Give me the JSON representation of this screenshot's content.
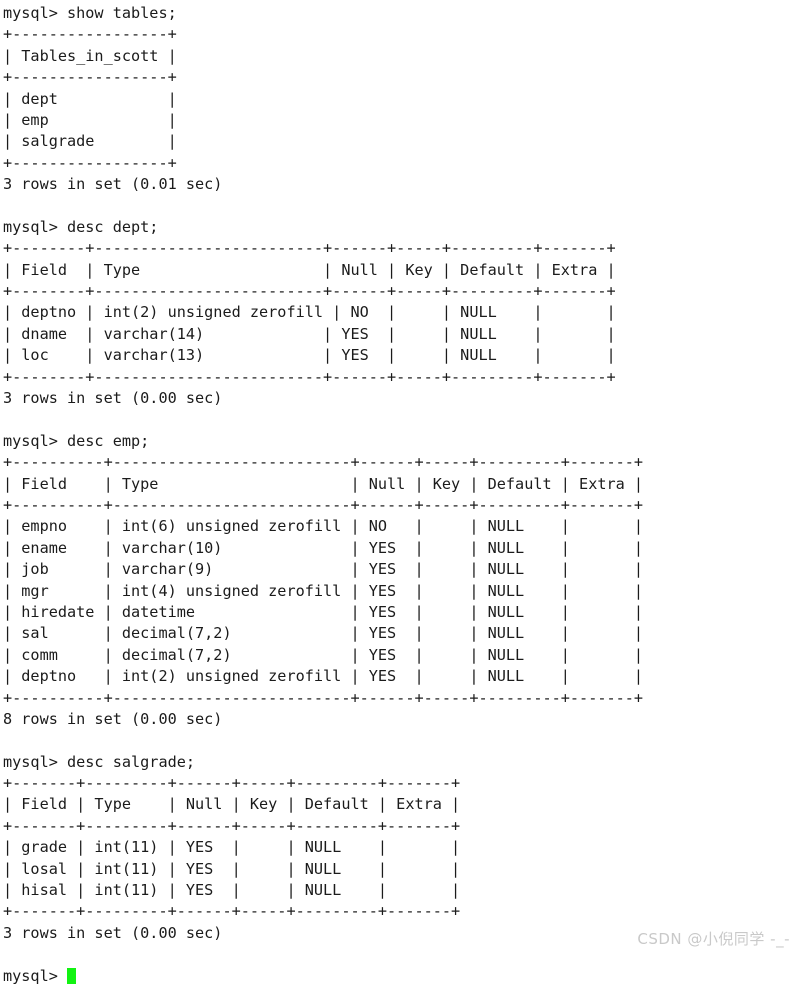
{
  "terminal": {
    "prompt": "mysql>",
    "cursor_color": "#12f312",
    "text_color": "#1b1b1b",
    "background_color": "#ffffff",
    "blocks": [
      {
        "command": "mysql> show tables;",
        "lines": [
          "+-----------------+",
          "| Tables_in_scott |",
          "+-----------------+",
          "| dept            |",
          "| emp             |",
          "| salgrade        |",
          "+-----------------+",
          "3 rows in set (0.01 sec)"
        ]
      },
      {
        "command": "mysql> desc dept;",
        "lines": [
          "+--------+-------------------------+------+-----+---------+-------+",
          "| Field  | Type                    | Null | Key | Default | Extra |",
          "+--------+-------------------------+------+-----+---------+-------+",
          "| deptno | int(2) unsigned zerofill | NO  |     | NULL    |       |",
          "| dname  | varchar(14)             | YES  |     | NULL    |       |",
          "| loc    | varchar(13)             | YES  |     | NULL    |       |",
          "+--------+-------------------------+------+-----+---------+-------+",
          "3 rows in set (0.00 sec)"
        ]
      },
      {
        "command": "mysql> desc emp;",
        "lines": [
          "+----------+--------------------------+------+-----+---------+-------+",
          "| Field    | Type                     | Null | Key | Default | Extra |",
          "+----------+--------------------------+------+-----+---------+-------+",
          "| empno    | int(6) unsigned zerofill | NO   |     | NULL    |       |",
          "| ename    | varchar(10)              | YES  |     | NULL    |       |",
          "| job      | varchar(9)               | YES  |     | NULL    |       |",
          "| mgr      | int(4) unsigned zerofill | YES  |     | NULL    |       |",
          "| hiredate | datetime                 | YES  |     | NULL    |       |",
          "| sal      | decimal(7,2)             | YES  |     | NULL    |       |",
          "| comm     | decimal(7,2)             | YES  |     | NULL    |       |",
          "| deptno   | int(2) unsigned zerofill | YES  |     | NULL    |       |",
          "+----------+--------------------------+------+-----+---------+-------+",
          "8 rows in set (0.00 sec)"
        ]
      },
      {
        "command": "mysql> desc salgrade;",
        "lines": [
          "+-------+---------+------+-----+---------+-------+",
          "| Field | Type    | Null | Key | Default | Extra |",
          "+-------+---------+------+-----+---------+-------+",
          "| grade | int(11) | YES  |     | NULL    |       |",
          "| losal | int(11) | YES  |     | NULL    |       |",
          "| hisal | int(11) | YES  |     | NULL    |       |",
          "+-------+---------+------+-----+---------+-------+",
          "3 rows in set (0.00 sec)"
        ]
      }
    ],
    "tables": {
      "show_tables": {
        "header": "Tables_in_scott",
        "rows": [
          "dept",
          "emp",
          "salgrade"
        ],
        "row_count": 3,
        "duration": "0.01 sec"
      },
      "dept": {
        "columns": [
          "Field",
          "Type",
          "Null",
          "Key",
          "Default",
          "Extra"
        ],
        "rows": [
          [
            "deptno",
            "int(2) unsigned zerofill",
            "NO",
            "",
            "NULL",
            ""
          ],
          [
            "dname",
            "varchar(14)",
            "YES",
            "",
            "NULL",
            ""
          ],
          [
            "loc",
            "varchar(13)",
            "YES",
            "",
            "NULL",
            ""
          ]
        ],
        "row_count": 3,
        "duration": "0.00 sec"
      },
      "emp": {
        "columns": [
          "Field",
          "Type",
          "Null",
          "Key",
          "Default",
          "Extra"
        ],
        "rows": [
          [
            "empno",
            "int(6) unsigned zerofill",
            "NO",
            "",
            "NULL",
            ""
          ],
          [
            "ename",
            "varchar(10)",
            "YES",
            "",
            "NULL",
            ""
          ],
          [
            "job",
            "varchar(9)",
            "YES",
            "",
            "NULL",
            ""
          ],
          [
            "mgr",
            "int(4) unsigned zerofill",
            "YES",
            "",
            "NULL",
            ""
          ],
          [
            "hiredate",
            "datetime",
            "YES",
            "",
            "NULL",
            ""
          ],
          [
            "sal",
            "decimal(7,2)",
            "YES",
            "",
            "NULL",
            ""
          ],
          [
            "comm",
            "decimal(7,2)",
            "YES",
            "",
            "NULL",
            ""
          ],
          [
            "deptno",
            "int(2) unsigned zerofill",
            "YES",
            "",
            "NULL",
            ""
          ]
        ],
        "row_count": 8,
        "duration": "0.00 sec"
      },
      "salgrade": {
        "columns": [
          "Field",
          "Type",
          "Null",
          "Key",
          "Default",
          "Extra"
        ],
        "rows": [
          [
            "grade",
            "int(11)",
            "YES",
            "",
            "NULL",
            ""
          ],
          [
            "losal",
            "int(11)",
            "YES",
            "",
            "NULL",
            ""
          ],
          [
            "hisal",
            "int(11)",
            "YES",
            "",
            "NULL",
            ""
          ]
        ],
        "row_count": 3,
        "duration": "0.00 sec"
      }
    }
  },
  "watermark": {
    "text": "CSDN @小倪同学 -_-"
  }
}
